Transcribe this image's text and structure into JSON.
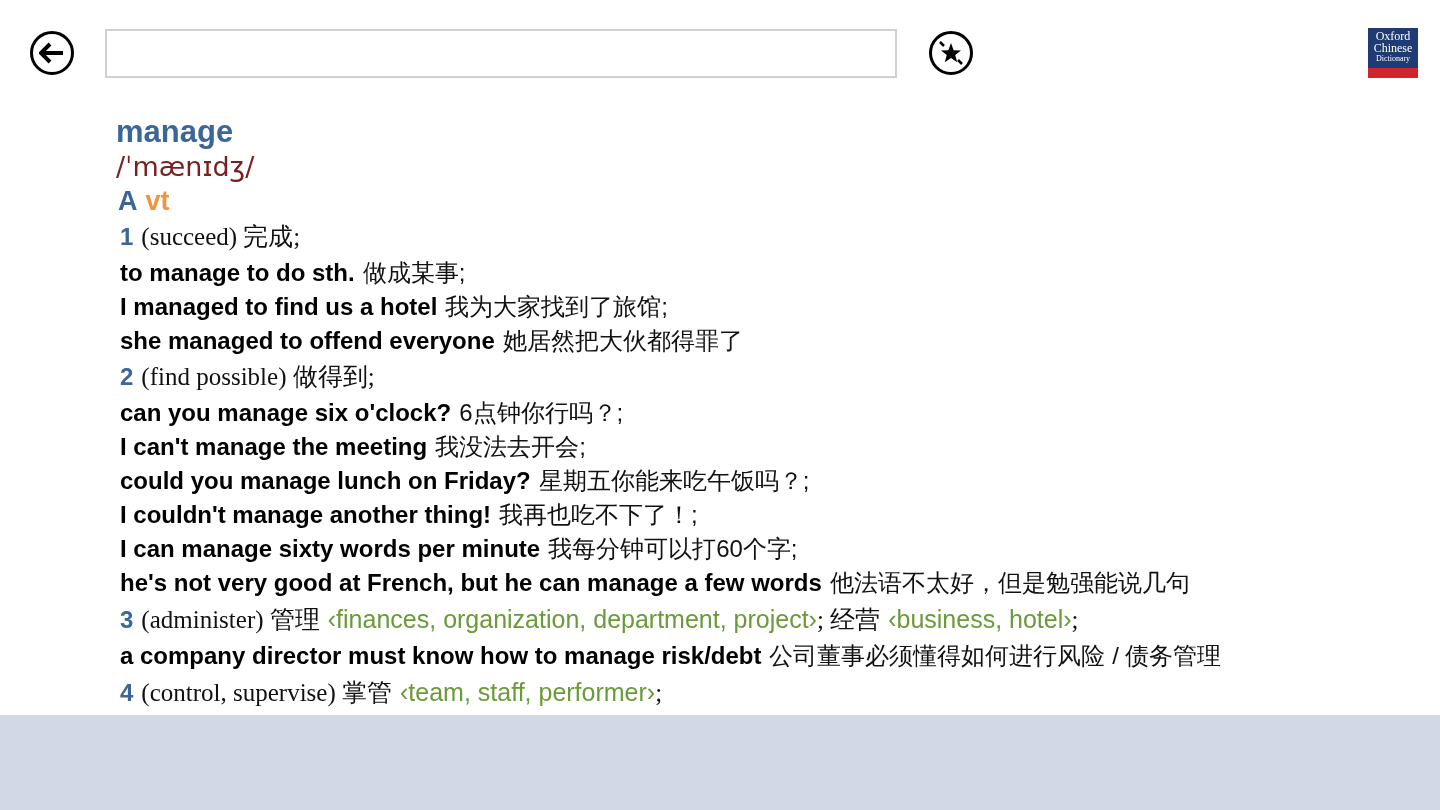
{
  "toolbar": {
    "logo": [
      "Oxford",
      "Chinese",
      "Dictionary"
    ]
  },
  "entry": {
    "headword": "manage",
    "pronunciation": "/ˈmænɪdʒ/",
    "pos": {
      "letter": "A",
      "label": "vt"
    },
    "senses": [
      {
        "number": "1",
        "gloss": [
          {
            "kind": "plain",
            "text": "(succeed) 完成;"
          }
        ],
        "examples": [
          {
            "en": "to manage to do sth.",
            "zh": "做成某事;"
          },
          {
            "en": "I managed to find us a hotel",
            "zh": "我为大家找到了旅馆;"
          },
          {
            "en": "she managed to offend everyone",
            "zh": "她居然把大伙都得罪了"
          }
        ]
      },
      {
        "number": "2",
        "gloss": [
          {
            "kind": "plain",
            "text": "(find possible) 做得到;"
          }
        ],
        "examples": [
          {
            "en": "can you manage six o'clock?",
            "zh": "6点钟你行吗？;"
          },
          {
            "en": "I can't manage the meeting",
            "zh": "我没法去开会;"
          },
          {
            "en": "could you manage lunch on Friday?",
            "zh": "星期五你能来吃午饭吗？;"
          },
          {
            "en": "I couldn't manage another thing!",
            "zh": "我再也吃不下了！;"
          },
          {
            "en": "I can manage sixty words per minute",
            "zh": "我每分钟可以打60个字;"
          },
          {
            "en": "he's not very good at French, but he can manage a few words",
            "zh": "他法语不太好，但是勉强能说几句"
          }
        ]
      },
      {
        "number": "3",
        "gloss": [
          {
            "kind": "plain",
            "text": "(administer) 管理"
          },
          {
            "kind": "collocate",
            "text": "‹finances, organization, department, project›"
          },
          {
            "kind": "plain",
            "text": "; 经营"
          },
          {
            "kind": "collocate",
            "text": "‹business, hotel›"
          },
          {
            "kind": "plain",
            "text": ";"
          }
        ],
        "examples": [
          {
            "en": "a company director must know how to manage risk/debt",
            "zh": "公司董事必须懂得如何进行风险 / 债务管理"
          }
        ]
      },
      {
        "number": "4",
        "gloss": [
          {
            "kind": "plain",
            "text": "(control, supervise) 掌管"
          },
          {
            "kind": "collocate",
            "text": "‹team, staff, performer›"
          },
          {
            "kind": "plain",
            "text": ";"
          }
        ]
      }
    ]
  }
}
